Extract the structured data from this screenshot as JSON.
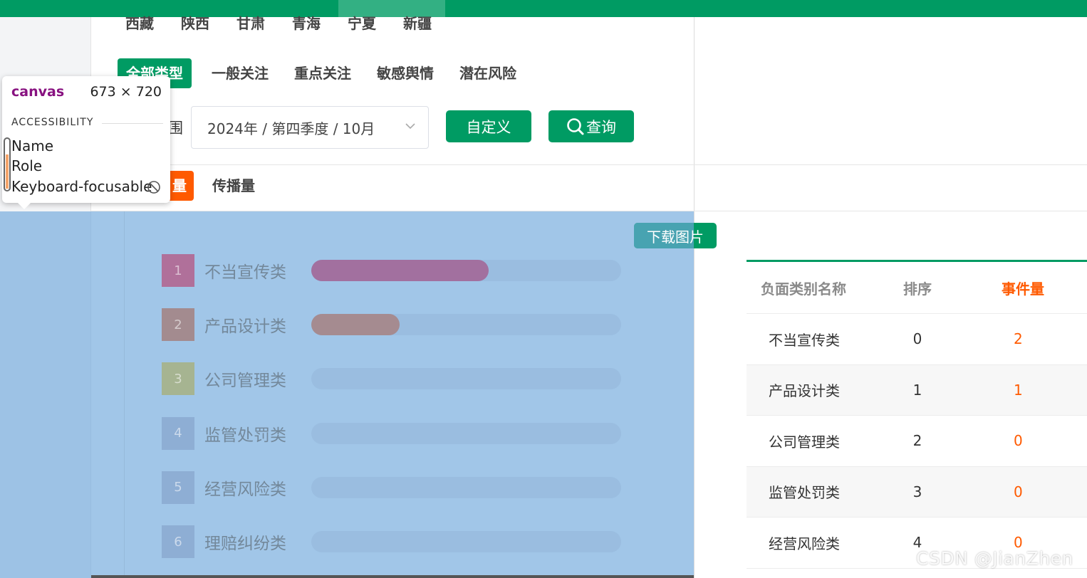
{
  "regions": [
    "西藏",
    "陕西",
    "甘肃",
    "青海",
    "宁夏",
    "新疆"
  ],
  "type_tabs": [
    {
      "label": "全部类型",
      "active": true
    },
    {
      "label": "一般关注",
      "active": false
    },
    {
      "label": "重点关注",
      "active": false
    },
    {
      "label": "敏感舆情",
      "active": false
    },
    {
      "label": "潜在风险",
      "active": false
    }
  ],
  "filter": {
    "range_label_partial": "围",
    "date_value": "2024年 / 第四季度 / 10月",
    "custom_button": "自定义",
    "query_button": "查询"
  },
  "metric_tabs": [
    {
      "label": "量",
      "active": true
    },
    {
      "label": "传播量",
      "active": false
    }
  ],
  "ranking": [
    {
      "rank": "1",
      "label": "不当宣传类",
      "value": 2,
      "badge_color": "#b0709a",
      "bar_color": "#a2709f"
    },
    {
      "rank": "2",
      "label": "产品设计类",
      "value": 1,
      "badge_color": "#a38b8f",
      "bar_color": "#a58b90"
    },
    {
      "rank": "3",
      "label": "公司管理类",
      "value": 0,
      "badge_color": "#a6b491",
      "bar_color": "#a6b491"
    },
    {
      "rank": "4",
      "label": "监管处罚类",
      "value": 0,
      "badge_color": "#8eaed4",
      "bar_color": "#8eaed4"
    },
    {
      "rank": "5",
      "label": "经营风险类",
      "value": 0,
      "badge_color": "#8eaed4",
      "bar_color": "#8eaed4"
    },
    {
      "rank": "6",
      "label": "理赔纠纷类",
      "value": 0,
      "badge_color": "#8eaed4",
      "bar_color": "#8eaed4"
    }
  ],
  "ranking_max": 3.5,
  "download_button": "下载图片",
  "table": {
    "headers": [
      "负面类别名称",
      "排序",
      "事件量"
    ],
    "rows": [
      [
        "不当宣传类",
        "0",
        "2"
      ],
      [
        "产品设计类",
        "1",
        "1"
      ],
      [
        "公司管理类",
        "2",
        "0"
      ],
      [
        "监管处罚类",
        "3",
        "0"
      ],
      [
        "经营风险类",
        "4",
        "0"
      ]
    ]
  },
  "watermark": "CSDN @JianZhen",
  "devtools_tooltip": {
    "element": "canvas",
    "size": "673 × 720",
    "section": "ACCESSIBILITY",
    "props": [
      "Name",
      "Role",
      "Keyboard-focusable"
    ]
  },
  "colors": {
    "brand_green": "#009b63",
    "accent_orange": "#ff5a00",
    "canvas_highlight": "#6fa8dc"
  }
}
